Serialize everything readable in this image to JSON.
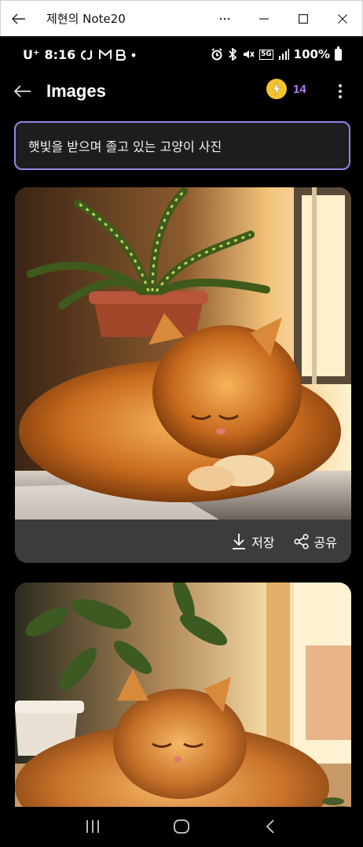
{
  "window": {
    "title": "제현의 Note20",
    "back_icon": "arrow-left-icon",
    "controls": [
      "more-icon",
      "minimize-icon",
      "maximize-icon",
      "close-icon"
    ]
  },
  "status_bar": {
    "carrier": "U⁺",
    "time": "8:16",
    "left_icons": [
      "cj-icon",
      "gmail-icon",
      "b-icon",
      "dot-icon"
    ],
    "right_icons": [
      "alarm-icon",
      "bluetooth-icon",
      "mute-icon",
      "5g-icon",
      "signal-icon"
    ],
    "network": "5G",
    "battery": "100%"
  },
  "app_bar": {
    "title": "Images",
    "credit_count": "14"
  },
  "prompt": {
    "text": "햇빛을 받으며 졸고 있는 고양이 사진"
  },
  "results": [
    {
      "image": "sleeping-orange-cat-on-windowsill-with-snake-plant",
      "save_label": "저장",
      "share_label": "공유"
    },
    {
      "image": "sleeping-orange-cat-by-sunny-window-with-houseplant"
    }
  ],
  "nav_bar": {
    "buttons": [
      "recents-icon",
      "home-icon",
      "back-icon"
    ]
  },
  "colors": {
    "accent_purple": "#b57bff",
    "prompt_border": "#9b82e6",
    "coin": "#f4c430",
    "card_bg": "#3c3c3e"
  }
}
